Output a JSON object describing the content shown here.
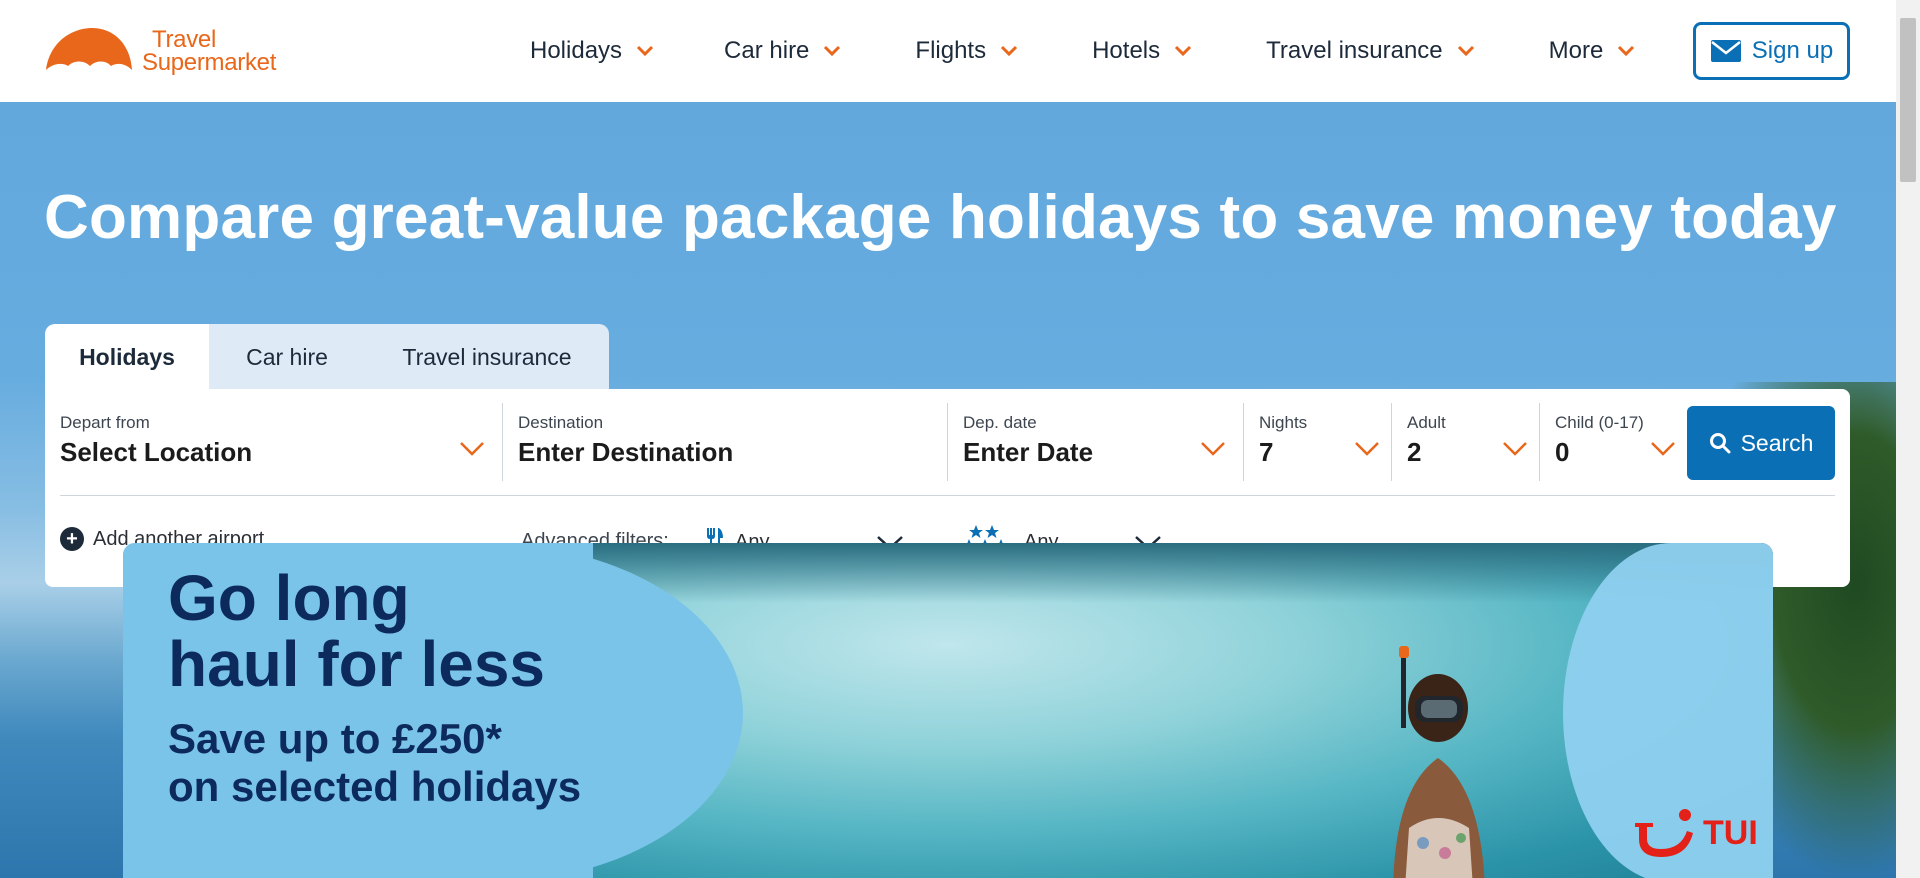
{
  "brand": {
    "line1": "Travel",
    "line2": "Supermarket",
    "color": "#e8671b"
  },
  "nav": {
    "items": [
      {
        "label": "Holidays",
        "icon": "chevron-down-icon"
      },
      {
        "label": "Car hire",
        "icon": "chevron-down-icon"
      },
      {
        "label": "Flights",
        "icon": "chevron-down-icon"
      },
      {
        "label": "Hotels",
        "icon": "chevron-down-icon"
      },
      {
        "label": "Travel insurance",
        "icon": "chevron-down-icon"
      },
      {
        "label": "More",
        "icon": "chevron-down-icon"
      }
    ],
    "signup_label": "Sign up",
    "signup_icon": "envelope-icon"
  },
  "hero": {
    "title": "Compare great-value package holidays to save money today"
  },
  "tabs": [
    {
      "label": "Holidays",
      "active": true
    },
    {
      "label": "Car hire",
      "active": false
    },
    {
      "label": "Travel insurance",
      "active": false
    }
  ],
  "search": {
    "depart": {
      "label": "Depart from",
      "value": "Select Location"
    },
    "destination": {
      "label": "Destination",
      "value": "Enter Destination"
    },
    "date": {
      "label": "Dep. date",
      "value": "Enter Date"
    },
    "nights": {
      "label": "Nights",
      "value": "7"
    },
    "adult": {
      "label": "Adult",
      "value": "2"
    },
    "child": {
      "label": "Child (0-17)",
      "value": "0"
    },
    "button_label": "Search",
    "add_airport": "Add another airport",
    "advanced_label": "Advanced filters:",
    "board_filter": {
      "icon": "cutlery-icon",
      "value": "Any"
    },
    "stars_filter": {
      "icon": "stars-icon",
      "value": "Any"
    }
  },
  "promo": {
    "headline_line1": "Go long",
    "headline_line2": "haul for less",
    "sub_line1": "Save up to £250*",
    "sub_line2": "on selected holidays",
    "brand": "TUI"
  },
  "colors": {
    "accent": "#0a6fb4",
    "orange": "#e8671b",
    "navy": "#0c2a5b",
    "tui_red": "#e32118"
  }
}
